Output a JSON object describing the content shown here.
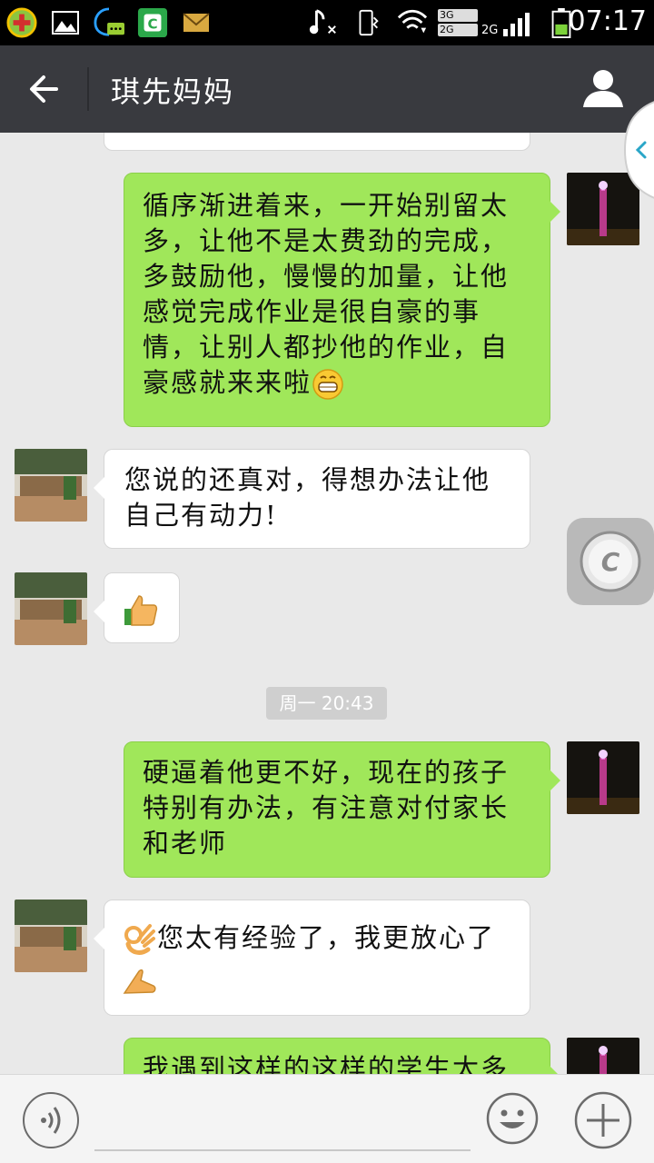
{
  "status_bar": {
    "time": "07:17",
    "net_top": "3G",
    "net_bottom": "2G",
    "net_label": "2G"
  },
  "header": {
    "title": "琪先妈妈"
  },
  "messages": [
    {
      "from": "me",
      "text": "循序渐进着来，一开始别留太多，让他不是太费劲的完成，多鼓励他，慢慢的加量，让他感觉完成作业是很自豪的事情，让别人都抄他的作业，自豪感就来来啦"
    },
    {
      "from": "them",
      "text": "您说的还真对，得想办法让他自己有动力!"
    },
    {
      "from": "them",
      "emoji": "thumbs-up-emoji"
    },
    {
      "from": "me",
      "text": "硬逼着他更不好，现在的孩子特别有办法，有注意对付家长和老师"
    },
    {
      "from": "them",
      "text": "您太有经验了，我更放心了"
    },
    {
      "from": "me",
      "text": "我遇到这样的这样的学生太多"
    }
  ],
  "timestamp": "周一 20:43",
  "floating_button": {
    "letter": "C"
  },
  "input": {
    "placeholder": ""
  },
  "colors": {
    "header_bg": "#393a3f",
    "chat_bg": "#e9e9e9",
    "outgoing_bubble": "#a0e75a",
    "incoming_bubble": "#ffffff"
  }
}
